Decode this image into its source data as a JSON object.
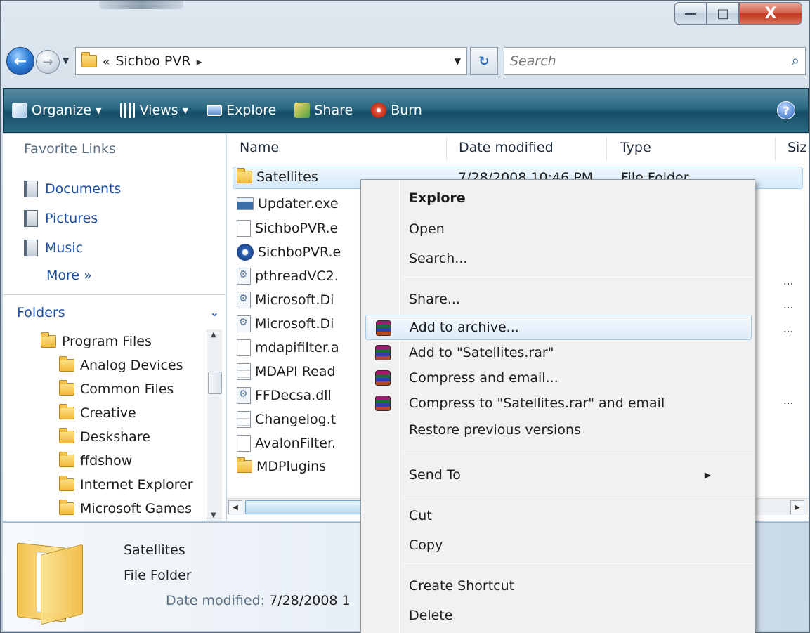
{
  "window": {
    "controls": {
      "minimize": "—",
      "maximize": "□",
      "close": "X"
    }
  },
  "address": {
    "prefix": "«",
    "breadcrumb": "Sichbo PVR",
    "separator": "▸",
    "search_placeholder": "Search"
  },
  "toolbar": {
    "items": [
      {
        "label": "Organize",
        "icon": "organize-icon",
        "dropdown": true
      },
      {
        "label": "Views",
        "icon": "views-icon",
        "dropdown": true
      },
      {
        "label": "Explore",
        "icon": "explore-icon",
        "dropdown": false
      },
      {
        "label": "Share",
        "icon": "share-icon",
        "dropdown": false
      },
      {
        "label": "Burn",
        "icon": "burn-icon",
        "dropdown": false
      }
    ],
    "help": "?"
  },
  "navpane": {
    "favorites_title": "Favorite Links",
    "favorites": [
      {
        "label": "Documents",
        "icon": "documents-icon"
      },
      {
        "label": "Pictures",
        "icon": "pictures-icon"
      },
      {
        "label": "Music",
        "icon": "music-icon"
      }
    ],
    "more": "More »",
    "folders_title": "Folders",
    "tree": [
      "Program Files",
      "Analog Devices",
      "Common Files",
      "Creative",
      "Deskshare",
      "ffdshow",
      "Internet Explorer",
      "Microsoft Games"
    ]
  },
  "filelist": {
    "columns": [
      "Name",
      "Date modified",
      "Type",
      "Siz"
    ],
    "selected_row": {
      "name": "Satellites",
      "date": "7/28/2008 10:46 PM",
      "type": "File Folder"
    },
    "rows": [
      {
        "name": "Satellites",
        "icon": "folder-icon"
      },
      {
        "name": "Updater.exe",
        "icon": "exe-icon"
      },
      {
        "name": "SichboPVR.e",
        "icon": "file-icon"
      },
      {
        "name": "SichboPVR.e",
        "icon": "service-icon"
      },
      {
        "name": "pthreadVC2.",
        "icon": "dll-icon"
      },
      {
        "name": "Microsoft.Di",
        "icon": "dll-icon"
      },
      {
        "name": "Microsoft.Di",
        "icon": "dll-icon"
      },
      {
        "name": "mdapifilter.a",
        "icon": "file-icon"
      },
      {
        "name": "MDAPI Read",
        "icon": "text-icon"
      },
      {
        "name": "FFDecsa.dll",
        "icon": "dll-icon"
      },
      {
        "name": "Changelog.t",
        "icon": "text-icon"
      },
      {
        "name": "AvalonFilter.",
        "icon": "file-icon"
      },
      {
        "name": "MDPlugins",
        "icon": "folder-icon"
      }
    ],
    "truncation_mark": "..."
  },
  "details": {
    "name": "Satellites",
    "type": "File Folder",
    "date_label": "Date modified:",
    "date_value": "7/28/2008 1"
  },
  "context_menu": {
    "items": [
      {
        "label": "Explore",
        "bold": true
      },
      {
        "label": "Open"
      },
      {
        "label": "Search..."
      },
      {
        "separator": true
      },
      {
        "label": "Share..."
      },
      {
        "label": "Add to archive...",
        "icon": "winrar-icon",
        "hover": true
      },
      {
        "label": "Add to \"Satellites.rar\"",
        "icon": "winrar-icon"
      },
      {
        "label": "Compress and email...",
        "icon": "winrar-icon"
      },
      {
        "label": "Compress to \"Satellites.rar\" and email",
        "icon": "winrar-icon"
      },
      {
        "label": "Restore previous versions"
      },
      {
        "separator": true
      },
      {
        "label": "Send To",
        "submenu": true
      },
      {
        "separator": true
      },
      {
        "label": "Cut"
      },
      {
        "label": "Copy"
      },
      {
        "separator": true
      },
      {
        "label": "Create Shortcut"
      },
      {
        "label": "Delete"
      }
    ]
  },
  "colors": {
    "toolbar": "#2c6a84",
    "link": "#1e4ea0",
    "selection": "#d5eafb",
    "close_button": "#c2361c"
  }
}
